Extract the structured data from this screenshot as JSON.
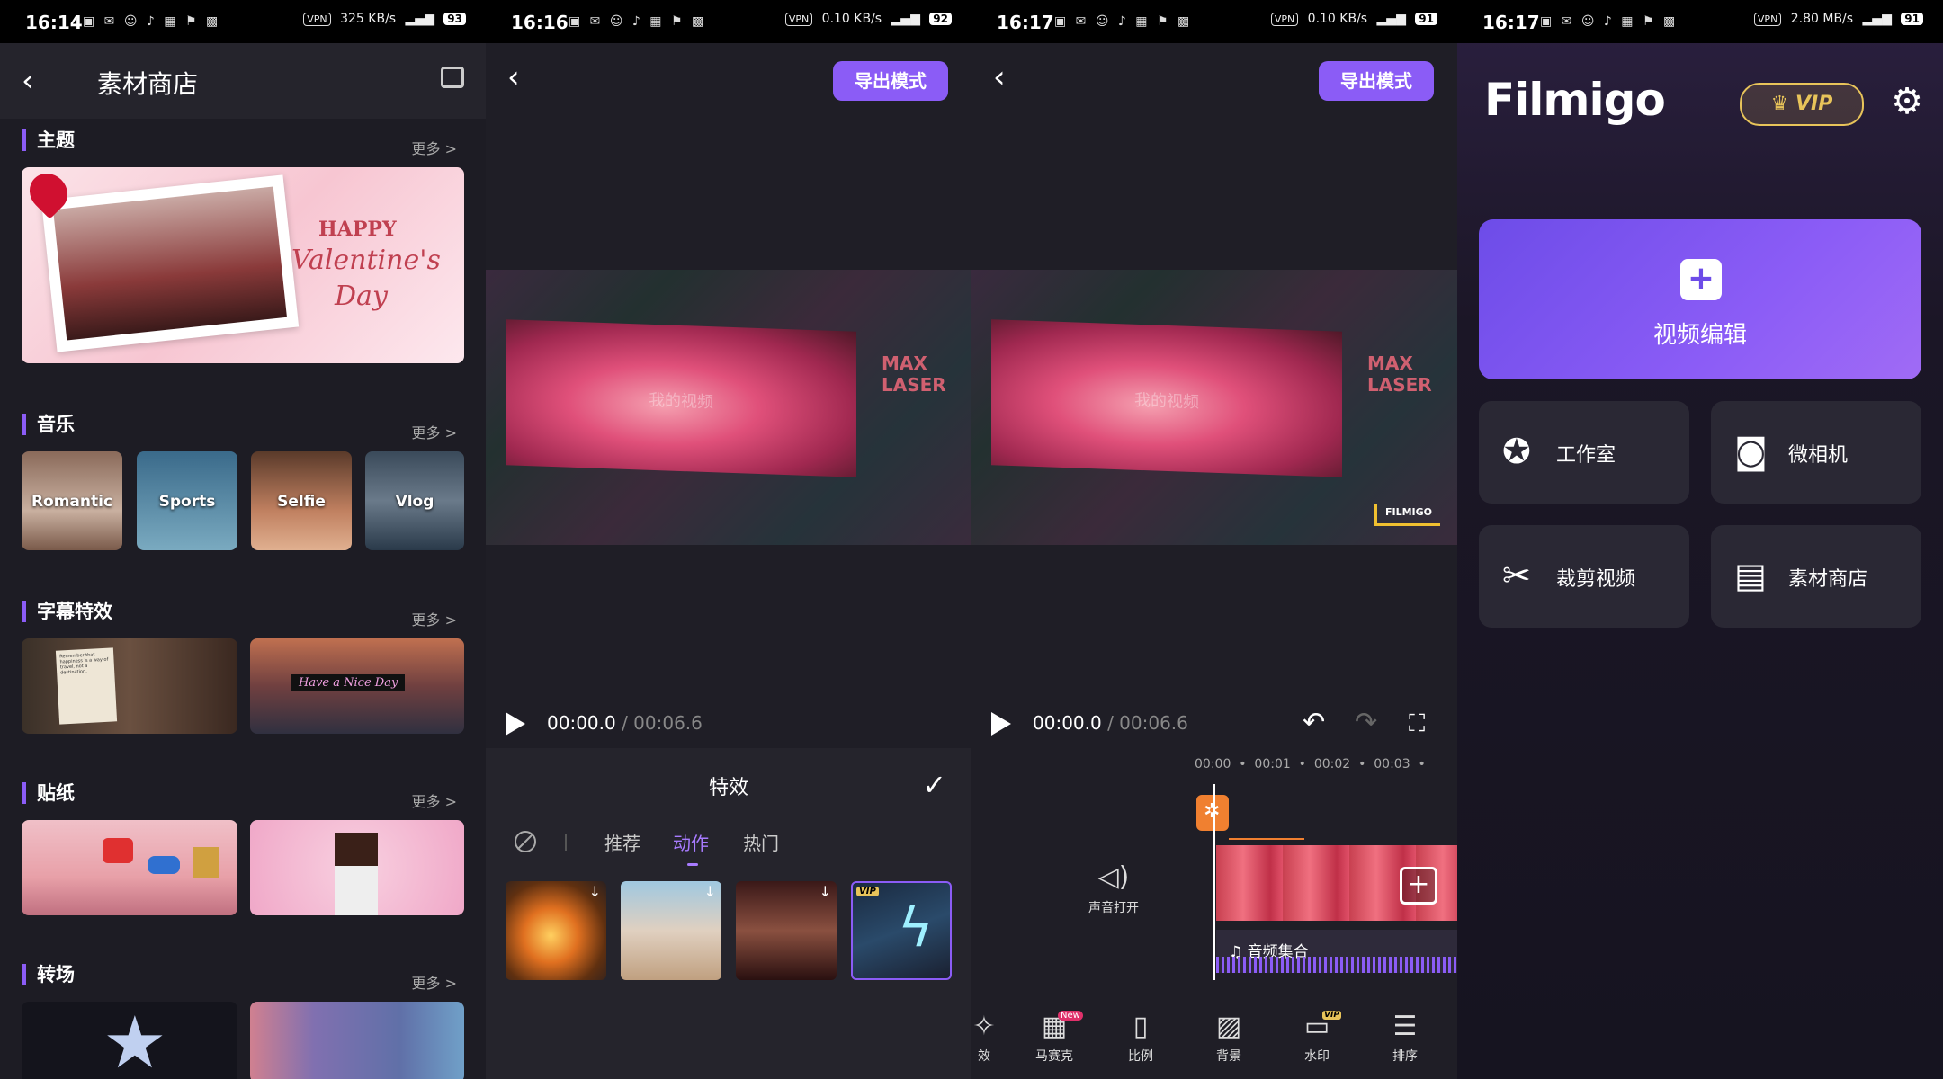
{
  "status": [
    {
      "time": "16:14",
      "speed": "325 KB/s",
      "battery": "93"
    },
    {
      "time": "16:16",
      "speed": "0.10 KB/s",
      "battery": "92"
    },
    {
      "time": "16:17",
      "speed": "0.10 KB/s",
      "battery": "91"
    },
    {
      "time": "16:17",
      "speed": "2.80 MB/s",
      "battery": "91"
    }
  ],
  "store": {
    "title": "素材商店",
    "more": "更多 >",
    "sections": {
      "theme": "主题",
      "music": "音乐",
      "caption": "字幕特效",
      "sticker": "贴纸",
      "transition": "转场"
    },
    "theme_banner": {
      "line1": "HAPPY",
      "line2": "Valentine's",
      "line3": "Day"
    },
    "music_items": [
      "Romantic",
      "Sports",
      "Selfie",
      "Vlog"
    ],
    "caption_text": "Have a Nice Day",
    "caption_note": "Remember that happiness is a way of travel, not a destination."
  },
  "editor": {
    "export_label": "导出模式",
    "video_overlay": "我的视频",
    "max_text": "MAX LASER",
    "time_current": "00:00.0",
    "time_total": " / 00:06.6",
    "watermark": "FILMIGO"
  },
  "effects": {
    "title": "特效",
    "tabs": [
      "推荐",
      "动作",
      "热门"
    ],
    "active_tab": 1,
    "vip": "VIP"
  },
  "timeline": {
    "ruler": [
      "00:00",
      "00:01",
      "00:02",
      "00:03"
    ],
    "sound_label": "声音打开",
    "audio_label": "音频集合",
    "tools": [
      "效",
      "马赛克",
      "比例",
      "背景",
      "水印",
      "排序"
    ],
    "new_tag": "New",
    "vip": "VIP"
  },
  "home": {
    "logo": "Filmigo",
    "vip": "VIP",
    "hero": "视频编辑",
    "tiles": [
      "工作室",
      "微相机",
      "裁剪视频",
      "素材商店"
    ]
  }
}
